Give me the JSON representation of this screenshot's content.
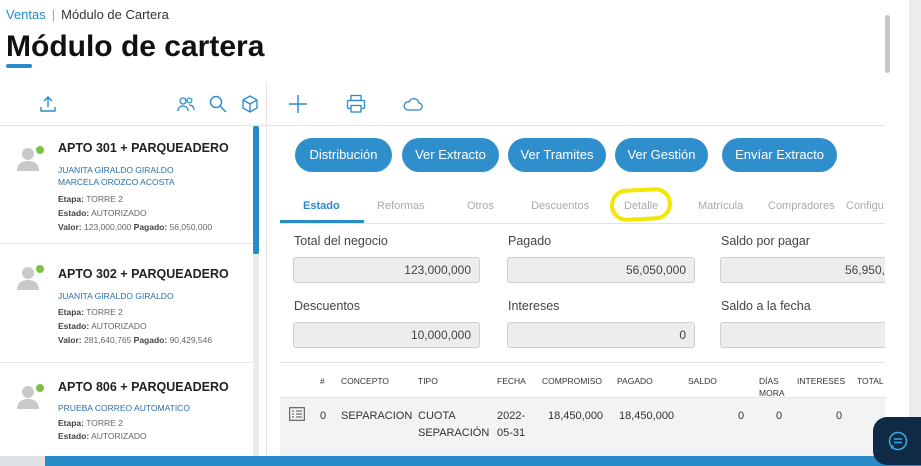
{
  "breadcrumb": {
    "parent": "Ventas",
    "separator": "|",
    "current": "Módulo de Cartera"
  },
  "page_title": "Módulo de cartera",
  "left_toolbar": {
    "icons": [
      "upload-icon",
      "users-icon",
      "search-icon",
      "box-icon"
    ]
  },
  "right_toolbar": {
    "icons": [
      "plus-icon",
      "printer-icon",
      "cloud-icon"
    ]
  },
  "units": [
    {
      "title": "APTO 301 + PARQUEADERO",
      "persons": [
        "JUANITA GIRALDO GIRALDO",
        "MARCELA OROZCO ACOSTA"
      ],
      "etapa_label": "Etapa:",
      "etapa": "TORRE 2",
      "estado_label": "Estado:",
      "estado": "AUTORIZADO",
      "valor_label": "Valor:",
      "valor": "123,000,000",
      "pagado_label": "Pagado:",
      "pagado": "56,050,000"
    },
    {
      "title": "APTO 302 + PARQUEADERO",
      "persons": [
        "JUANITA GIRALDO GIRALDO"
      ],
      "etapa_label": "Etapa:",
      "etapa": "TORRE 2",
      "estado_label": "Estado:",
      "estado": "AUTORIZADO",
      "valor_label": "Valor:",
      "valor": "281,640,765",
      "pagado_label": "Pagado:",
      "pagado": "90,429,546"
    },
    {
      "title": "APTO 806 + PARQUEADERO",
      "persons": [
        "PRUEBA CORREO AUTOMATICO"
      ],
      "etapa_label": "Etapa:",
      "etapa": "TORRE 2",
      "estado_label": "Estado:",
      "estado": "AUTORIZADO"
    }
  ],
  "actions": [
    "Distribución",
    "Ver Extracto",
    "Ver Tramites",
    "Ver Gestión",
    "Envíar Extracto"
  ],
  "tabs": [
    "Estado",
    "Reformas",
    "Otros",
    "Descuentos",
    "Detalle",
    "Matrícula",
    "Compradores",
    "Configu"
  ],
  "active_tab": "Estado",
  "fields": {
    "total_negocio": {
      "label": "Total del negocio",
      "value": "123,000,000"
    },
    "pagado": {
      "label": "Pagado",
      "value": "56,050,000"
    },
    "saldo_pagar": {
      "label": "Saldo por pagar",
      "value": "56,950,"
    },
    "descuentos": {
      "label": "Descuentos",
      "value": "10,000,000"
    },
    "intereses": {
      "label": "Intereses",
      "value": "0"
    },
    "saldo_fecha": {
      "label": "Saldo a la fecha",
      "value": ""
    }
  },
  "table": {
    "headers": {
      "num": "#",
      "concepto": "CONCEPTO",
      "tipo": "TIPO",
      "fecha": "FECHA",
      "compromiso": "COMPROMISO",
      "pagado": "PAGADO",
      "saldo": "SALDO",
      "dias_mora_1": "DÍAS",
      "dias_mora_2": "MORA",
      "intereses": "INTERESES",
      "total": "TOTAL"
    },
    "row": {
      "num": "0",
      "concepto": "SEPARACION",
      "tipo_1": "CUOTA",
      "tipo_2": "SEPARACIÓN",
      "fecha_1": "2022-",
      "fecha_2": "05-31",
      "compromiso": "18,450,000",
      "pagado": "18,450,000",
      "saldo": "0",
      "dias_mora": "0",
      "intereses": "0"
    }
  },
  "colors": {
    "accent": "#2a8bc9",
    "button": "#2f8fcc",
    "highlight": "#f3e600",
    "chat": "#0f2a44",
    "online": "#7bc142"
  }
}
